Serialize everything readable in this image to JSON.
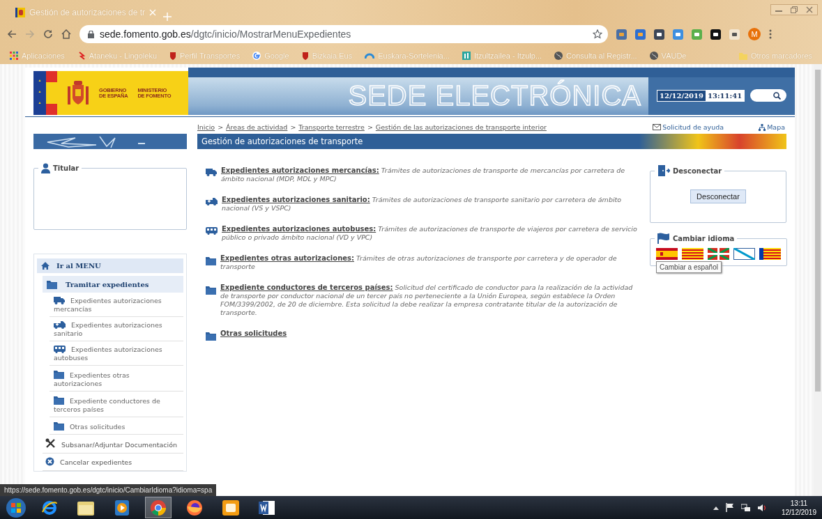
{
  "browser": {
    "tab_title": "Gestión de autorizaciones de tr",
    "url_host": "sede.fomento.gob.es",
    "url_path": "/dgtc/inicio/MostrarMenuExpedientes",
    "profile_initial": "M",
    "bookmarks": [
      {
        "kind": "apps",
        "label": "Aplicaciones"
      },
      {
        "kind": "red",
        "label": "Ataneku - Lingoleku"
      },
      {
        "kind": "shield",
        "label": "Perfil Transportes"
      },
      {
        "kind": "google",
        "label": "Google"
      },
      {
        "kind": "shield",
        "label": "Bizkaia.Eus"
      },
      {
        "kind": "arc",
        "label": "Euskara-Sortelenia..."
      },
      {
        "kind": "it",
        "label": "Itzultzailea - Itzulp..."
      },
      {
        "kind": "globe",
        "label": "Consulta al Registr..."
      },
      {
        "kind": "globe",
        "label": "VAUDe"
      }
    ],
    "other_bookmarks": "Otros marcadores"
  },
  "header": {
    "gov_line1": "GOBIERNO",
    "gov_line2": "DE ESPAÑA",
    "ministry_line1": "MINISTERIO",
    "ministry_line2": "DE FOMENTO",
    "banner_title": "SEDE ELECTRÓNICA",
    "date": "12/12/2019",
    "time": "13:11:41"
  },
  "breadcrumb": {
    "separator": ">",
    "items": [
      "Inicio",
      "Áreas de actividad",
      "Transporte terrestre",
      "Gestión de las autorizaciones de transporte interior"
    ]
  },
  "help_link": "Solicitud de ayuda",
  "map_link": "Mapa",
  "page_title": "Gestión de autorizaciones de transporte",
  "titular": {
    "legend": "Titular"
  },
  "menu": {
    "home": "Ir al MENU",
    "section": "Tramitar expedientes",
    "items": [
      {
        "kind": "truck",
        "label": "Expedientes autorizaciones mercancías"
      },
      {
        "kind": "ambulance",
        "label": "Expedientes autorizaciones sanitario"
      },
      {
        "kind": "bus",
        "label": "Expedientes autorizaciones autobuses"
      },
      {
        "kind": "folder",
        "label": "Expedientes otras autorizaciones"
      },
      {
        "kind": "folder",
        "label": "Expediente conductores de terceros países"
      },
      {
        "kind": "folder",
        "label": "Otras solicitudes"
      }
    ],
    "others": [
      {
        "kind": "tools",
        "label": "Subsanar/Adjuntar Documentación"
      },
      {
        "kind": "cancel",
        "label": "Cancelar expedientes"
      }
    ]
  },
  "entries": [
    {
      "kind": "truck",
      "title": "Expedientes autorizaciones mercancías:",
      "description": "Trámites de autorizaciones de transporte de mercancías por carretera de ámbito nacional (MDP, MDL y MPC)"
    },
    {
      "kind": "ambulance",
      "title": "Expedientes autorizaciones sanitario:",
      "description": "Trámites de autorizaciones de transporte sanitario por carretera de ámbito nacional (VS y VSPC)"
    },
    {
      "kind": "bus",
      "title": "Expedientes autorizaciones autobuses:",
      "description": "Trámites de autorizaciones de transporte de viajeros por carretera de servicio público o privado ámbito nacional (VD y VPC)"
    },
    {
      "kind": "folder",
      "title": "Expedientes otras autorizaciones:",
      "description": "Trámites de otras autorizaciones de transporte por carretera y de operador de transporte"
    },
    {
      "kind": "folder",
      "title": "Expediente conductores de terceros países:",
      "description": "Solicitud del certificado de conductor para la realización de la actividad de transporte por conductor nacional de un tercer país no perteneciente a la Unión Europea, según establece la Orden FOM/3399/2002, de 20 de diciembre. Esta solicitud la debe realizar la empresa contratante titular de la autorización de transporte."
    },
    {
      "kind": "folder",
      "title": "Otras solicitudes"
    }
  ],
  "disconnect": {
    "legend": "Desconectar",
    "button": "Desconectar"
  },
  "language": {
    "legend": "Cambiar idioma",
    "tooltip": "Cambiar a español",
    "flags": [
      {
        "kind": "spain"
      },
      {
        "kind": "catalonia"
      },
      {
        "kind": "basque"
      },
      {
        "kind": "galicia"
      },
      {
        "kind": "valencia"
      }
    ]
  },
  "status_url": "https://sede.fomento.gob.es/dgtc/inicio/CambiarIdioma?idioma=spa",
  "taskbar": {
    "time": "13:11",
    "date": "12/12/2019",
    "apps": [
      {
        "kind": "ie",
        "selected": false
      },
      {
        "kind": "files",
        "selected": false
      },
      {
        "kind": "media",
        "selected": false
      },
      {
        "kind": "chrome",
        "selected": true
      },
      {
        "kind": "firefox",
        "selected": false
      },
      {
        "kind": "orange",
        "selected": false
      },
      {
        "kind": "word",
        "selected": false
      }
    ]
  }
}
